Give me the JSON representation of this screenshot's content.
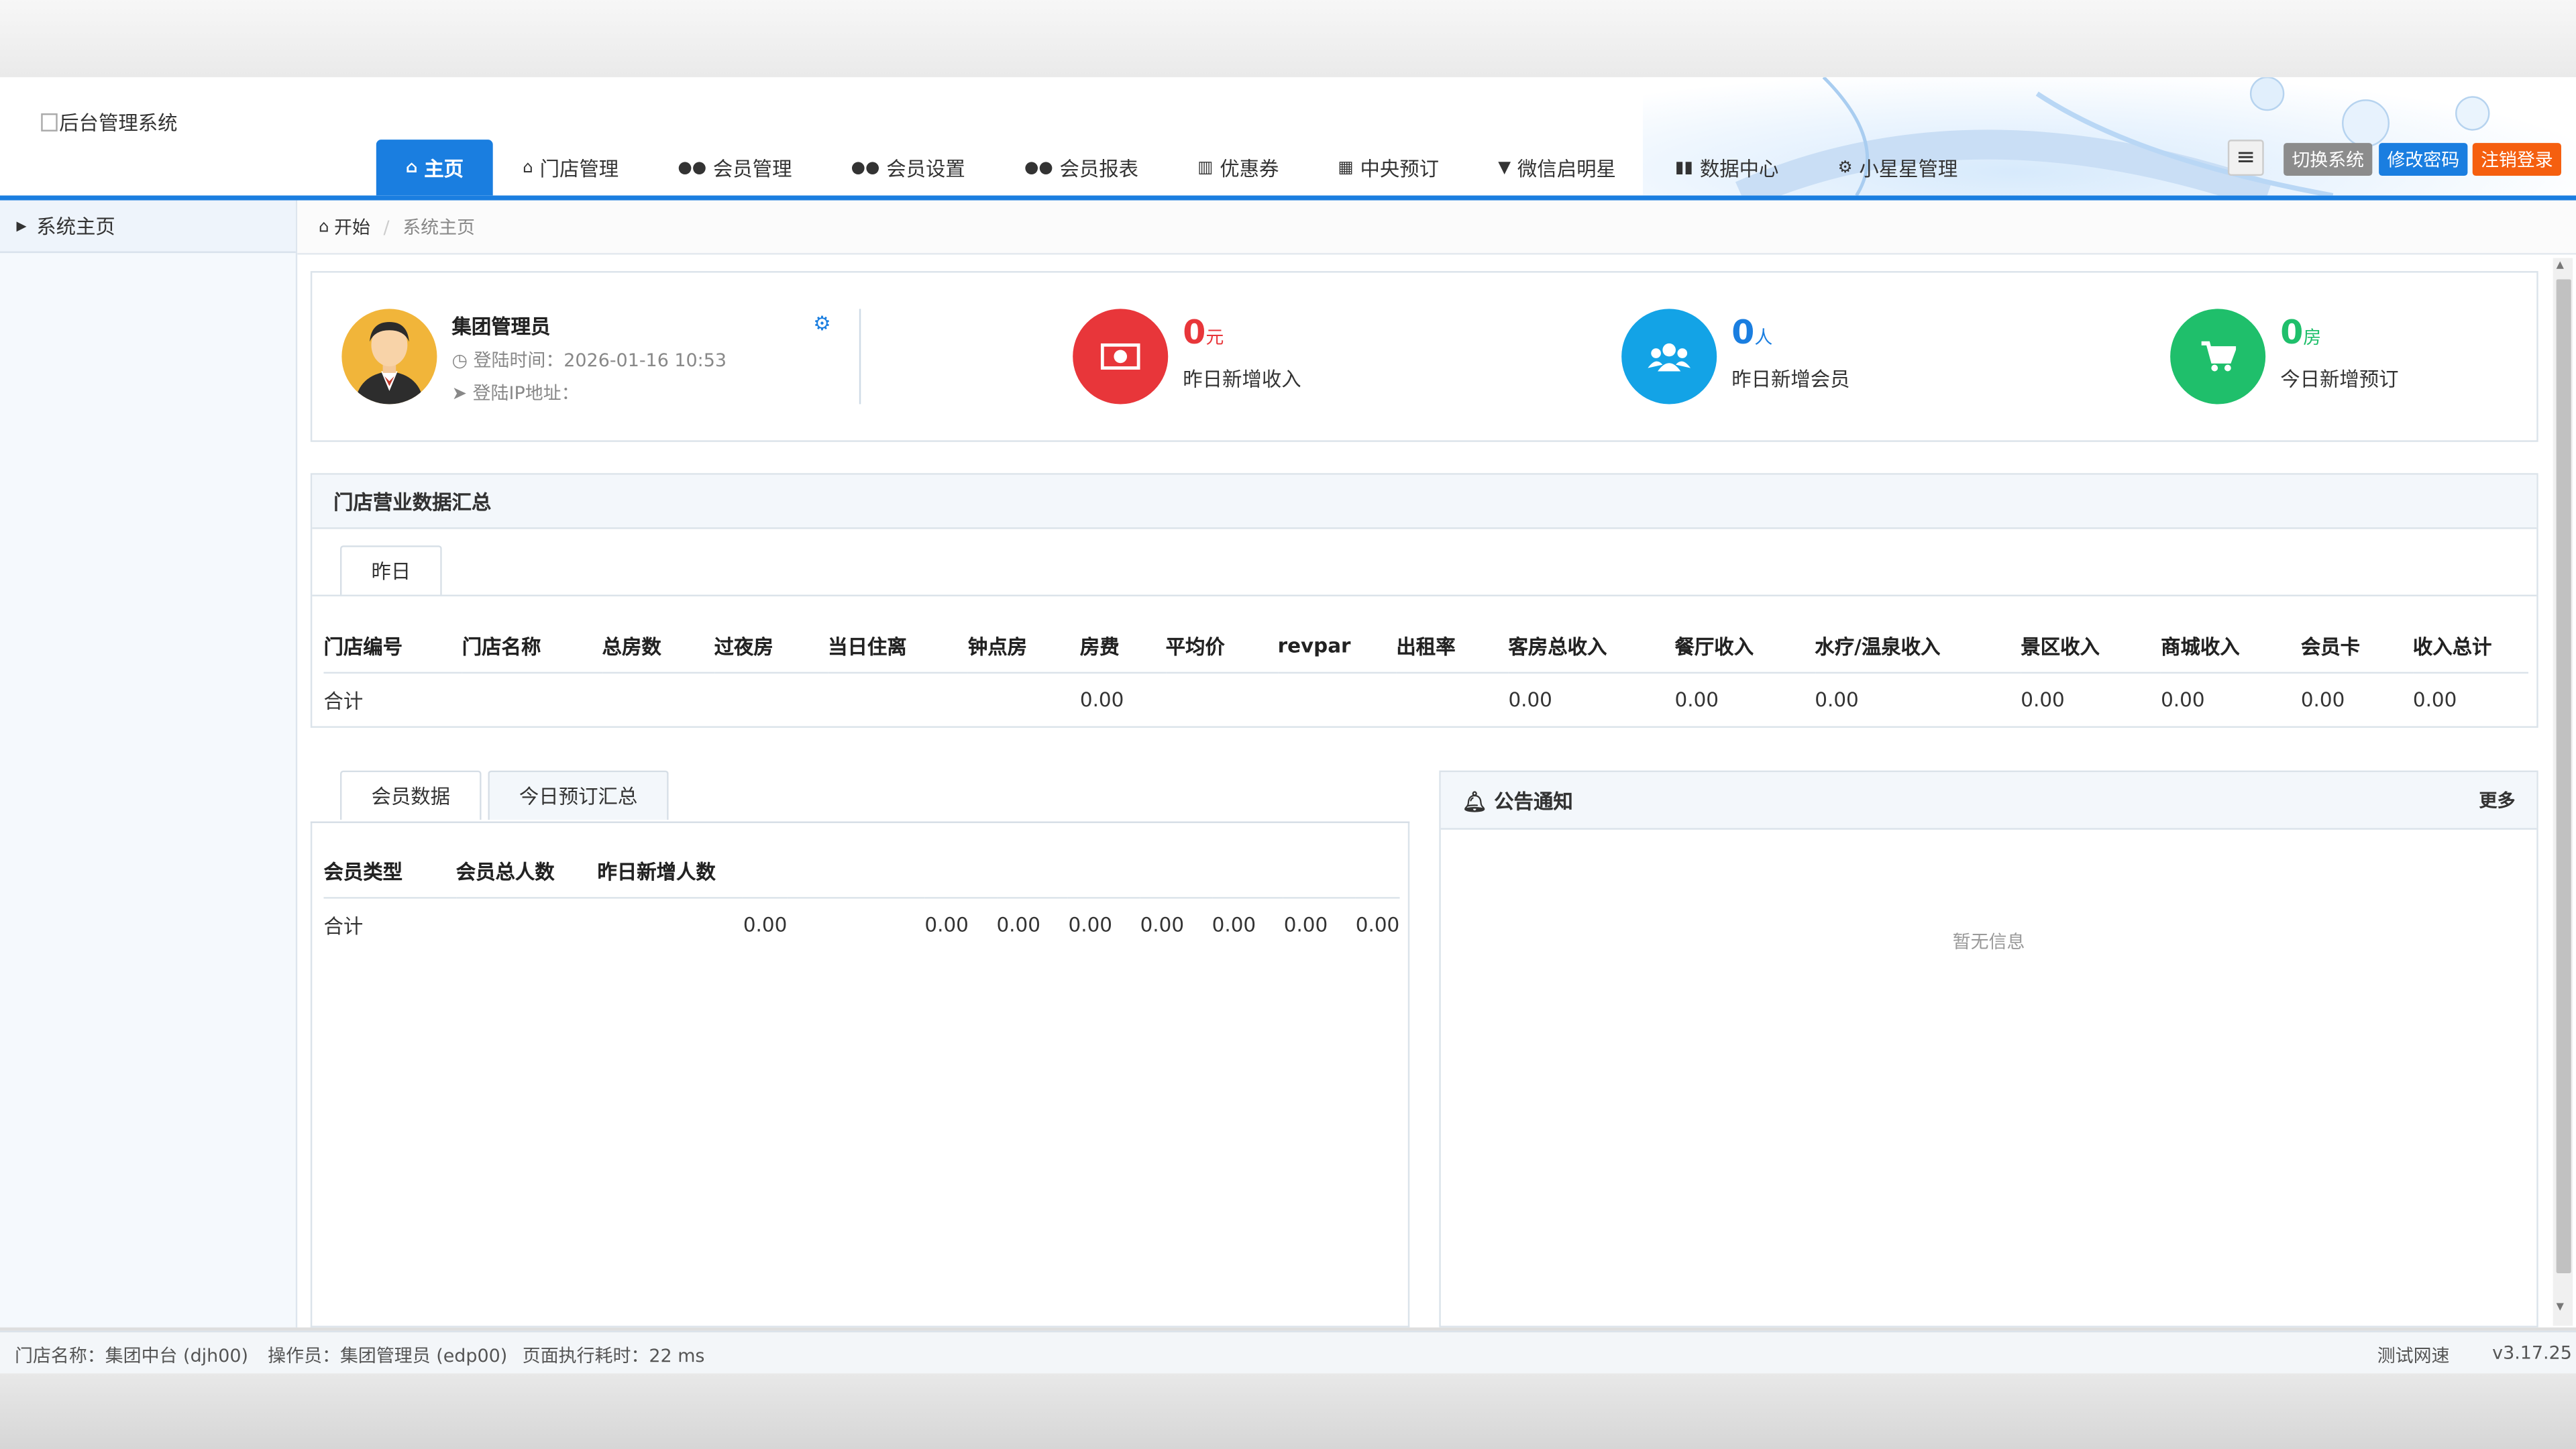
{
  "app": {
    "logo_alt": "后台管理系统"
  },
  "nav": [
    {
      "label": "主页",
      "icon": "home-icon",
      "active": true
    },
    {
      "label": "门店管理",
      "icon": "home-icon"
    },
    {
      "label": "会员管理",
      "icon": "users-icon"
    },
    {
      "label": "会员设置",
      "icon": "users-icon"
    },
    {
      "label": "会员报表",
      "icon": "users-icon"
    },
    {
      "label": "优惠券",
      "icon": "barcode-icon"
    },
    {
      "label": "中央预订",
      "icon": "calendar-icon"
    },
    {
      "label": "微信启明星",
      "icon": "cart-icon"
    },
    {
      "label": "数据中心",
      "icon": "bar-chart-icon"
    },
    {
      "label": "小星星管理",
      "icon": "cogs-icon"
    }
  ],
  "top_buttons": {
    "menu": "≡",
    "switch": "切换系统",
    "pwd": "修改密码",
    "logout": "注销登录"
  },
  "sidebar": {
    "items": [
      {
        "label": "系统主页"
      }
    ]
  },
  "breadcrumb": {
    "home": "开始",
    "current": "系统主页"
  },
  "profile": {
    "name": "集团管理员",
    "login_time": "登陆时间：2026-01-16 10:53",
    "login_ip": "登陆IP地址："
  },
  "stats": [
    {
      "value": "0",
      "unit": "元",
      "label": "昨日新增收入",
      "color": "#e8363a",
      "icon": "money-icon"
    },
    {
      "value": "0",
      "unit": "人",
      "label": "昨日新增会员",
      "color": "#13a3e6",
      "icon": "users-icon"
    },
    {
      "value": "0",
      "unit": "房",
      "label": "今日新增预订",
      "color": "#1fbf6b",
      "icon": "cart-icon"
    }
  ],
  "business": {
    "title": "门店营业数据汇总",
    "tab": "昨日",
    "headers": [
      "门店编号",
      "门店名称",
      "总房数",
      "过夜房",
      "当日住离",
      "钟点房",
      "房费",
      "平均价",
      "revpar",
      "出租率",
      "客房总收入",
      "餐厅收入",
      "水疗/温泉收入",
      "景区收入",
      "商城收入",
      "会员卡",
      "收入总计"
    ],
    "total_label": "合计",
    "total_values": [
      "0.00",
      "0.00",
      "0.00",
      "0.00",
      "0.00",
      "0.00",
      "0.00",
      "0.00"
    ]
  },
  "member": {
    "tabs": [
      "会员数据",
      "今日预订汇总"
    ],
    "headers": [
      "会员类型",
      "会员总人数",
      "昨日新增人数"
    ],
    "total_label": "合计",
    "total_values": [
      "0.00",
      "0.00",
      "0.00",
      "0.00",
      "0.00",
      "0.00",
      "0.00",
      "0.00"
    ]
  },
  "notice": {
    "title": "公告通知",
    "more": "更多",
    "empty": "暂无信息"
  },
  "footer": {
    "store": "门店名称：集团中台 (djh00)",
    "operator": "操作员：集团管理员 (edp00)",
    "exec": "页面执行耗时：22 ms",
    "speed": "测试网速",
    "version": "v3.17.25"
  }
}
